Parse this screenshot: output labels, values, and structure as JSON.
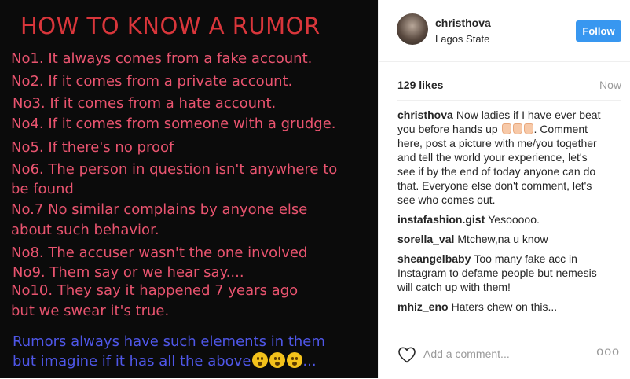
{
  "photo": {
    "title": "HOW TO KNOW A RUMOR",
    "lines": [
      "No1. It always comes from a fake account.",
      "No2. If it comes from a private account.",
      "No3. If it comes from a hate account.",
      "No4. If it comes from someone with a grudge.",
      "No5. If there's no proof",
      "No6. The person in question isn't anywhere to",
      "be found",
      "No.7 No similar complains by anyone else",
      "about such behavior.",
      "No8. The accuser wasn't the one involved",
      "No9. Them say or we hear say....",
      "No10. They say it happened 7 years ago",
      "but we swear it's true."
    ],
    "footer_line1": "Rumors always have such elements in them",
    "footer_line2": "but imagine if it has all the above",
    "footer_ellipsis": "...",
    "colors": {
      "background": "#0b0b0b",
      "title": "#d9363b",
      "text": "#e9546f",
      "footer": "#4f57e8"
    }
  },
  "header": {
    "username": "christhova",
    "location": "Lagos State",
    "follow_label": "Follow"
  },
  "stats": {
    "likes": "129 likes",
    "time": "Now"
  },
  "comments": [
    {
      "author": "christhova",
      "text_before": "Now ladies if I have ever beat you before hands up",
      "text_after": ". Comment here, post a picture with me/you together and tell the world your experience, let's see if by the end of today anyone can do that. Everyone else don't comment, let's see who comes out."
    },
    {
      "author": "instafashion.gist",
      "text": "Yesooooo."
    },
    {
      "author": "sorella_val",
      "text": "Mtchew,na u know"
    },
    {
      "author": "sheangelbaby",
      "text": "Too many fake acc in Instagram to defame people but nemesis will catch up with them!"
    },
    {
      "author": "mhiz_eno",
      "text": "Haters chew on this..."
    }
  ],
  "bottom": {
    "add_comment_placeholder": "Add a comment...",
    "more_label": "ooo",
    "icons": [
      "heart-icon",
      "more-options-icon"
    ]
  },
  "accent_color": "#3897f0"
}
